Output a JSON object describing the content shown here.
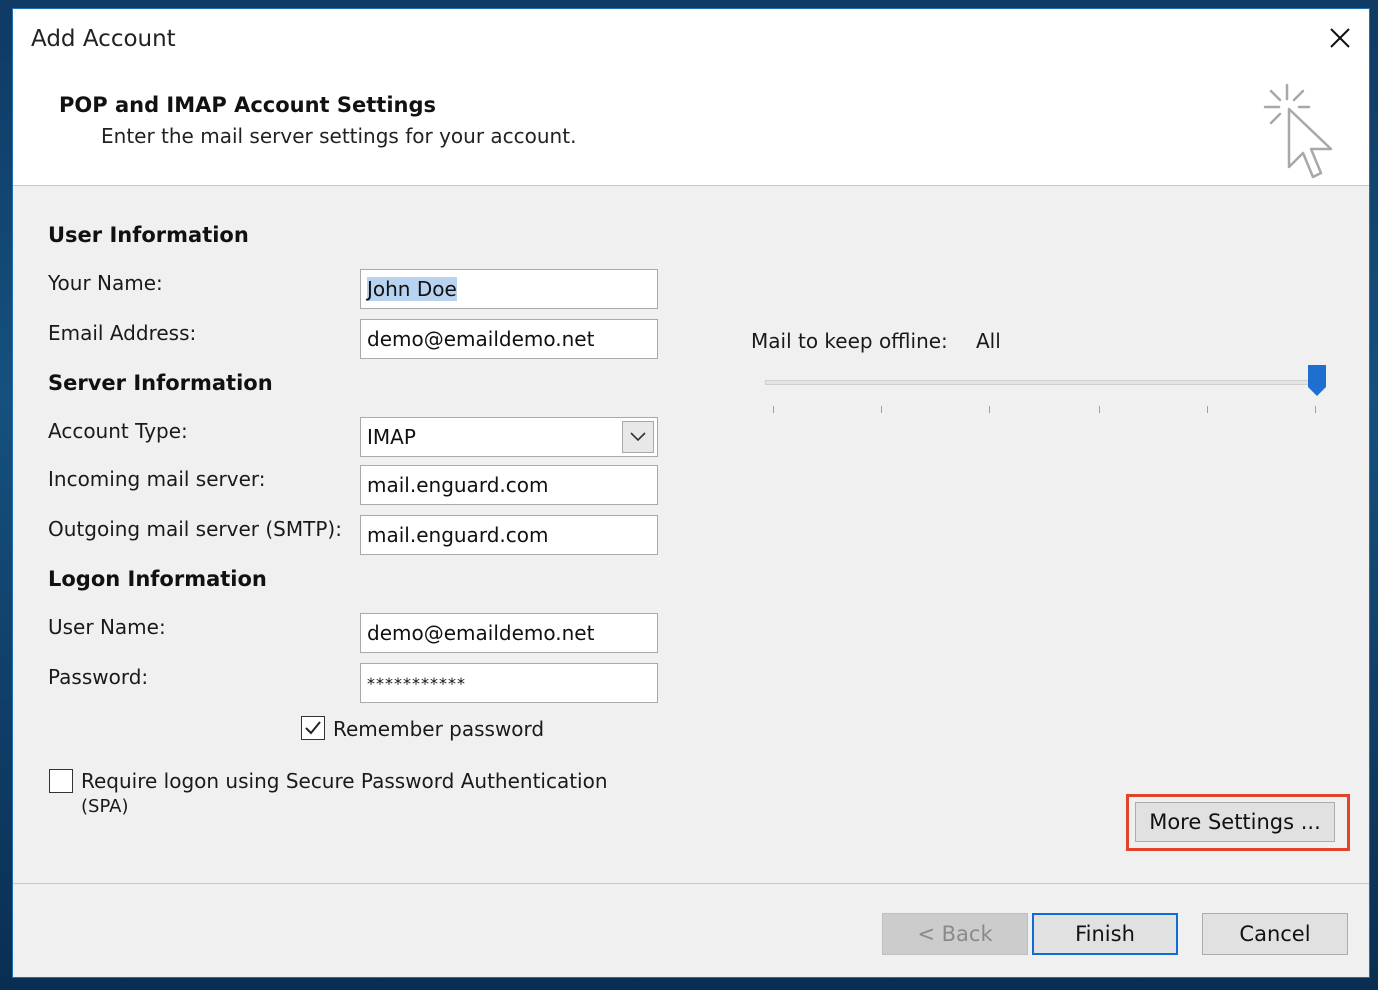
{
  "window": {
    "title": "Add Account"
  },
  "header": {
    "title": "POP and IMAP Account Settings",
    "subtitle": "Enter the mail server settings for your account."
  },
  "user_info": {
    "section_label": "User Information",
    "name_label": "Your Name:",
    "name_value": "John Doe",
    "email_label": "Email Address:",
    "email_value": "demo@emaildemo.net"
  },
  "server_info": {
    "section_label": "Server Information",
    "account_type_label": "Account Type:",
    "account_type_value": "IMAP",
    "incoming_label": "Incoming mail server:",
    "incoming_value": "mail.enguard.com",
    "outgoing_label": "Outgoing mail server (SMTP):",
    "outgoing_value": "mail.enguard.com"
  },
  "logon_info": {
    "section_label": "Logon Information",
    "username_label": "User Name:",
    "username_value": "demo@emaildemo.net",
    "password_label": "Password:",
    "password_value": "***********",
    "remember_label": "Remember password",
    "remember_checked": true,
    "spa_label_line1": "Require logon using Secure Password Authentication",
    "spa_label_line2": "(SPA)",
    "spa_checked": false
  },
  "offline": {
    "label": "Mail to keep offline:",
    "value": "All",
    "slider_position_fraction": 1.0
  },
  "buttons": {
    "more_settings": "More Settings ...",
    "back": "< Back",
    "finish": "Finish",
    "cancel": "Cancel"
  },
  "colors": {
    "accent": "#0f6cd6",
    "highlight": "#e0442a",
    "selection": "#b8d3f0",
    "slider_thumb": "#1f6fd0"
  }
}
